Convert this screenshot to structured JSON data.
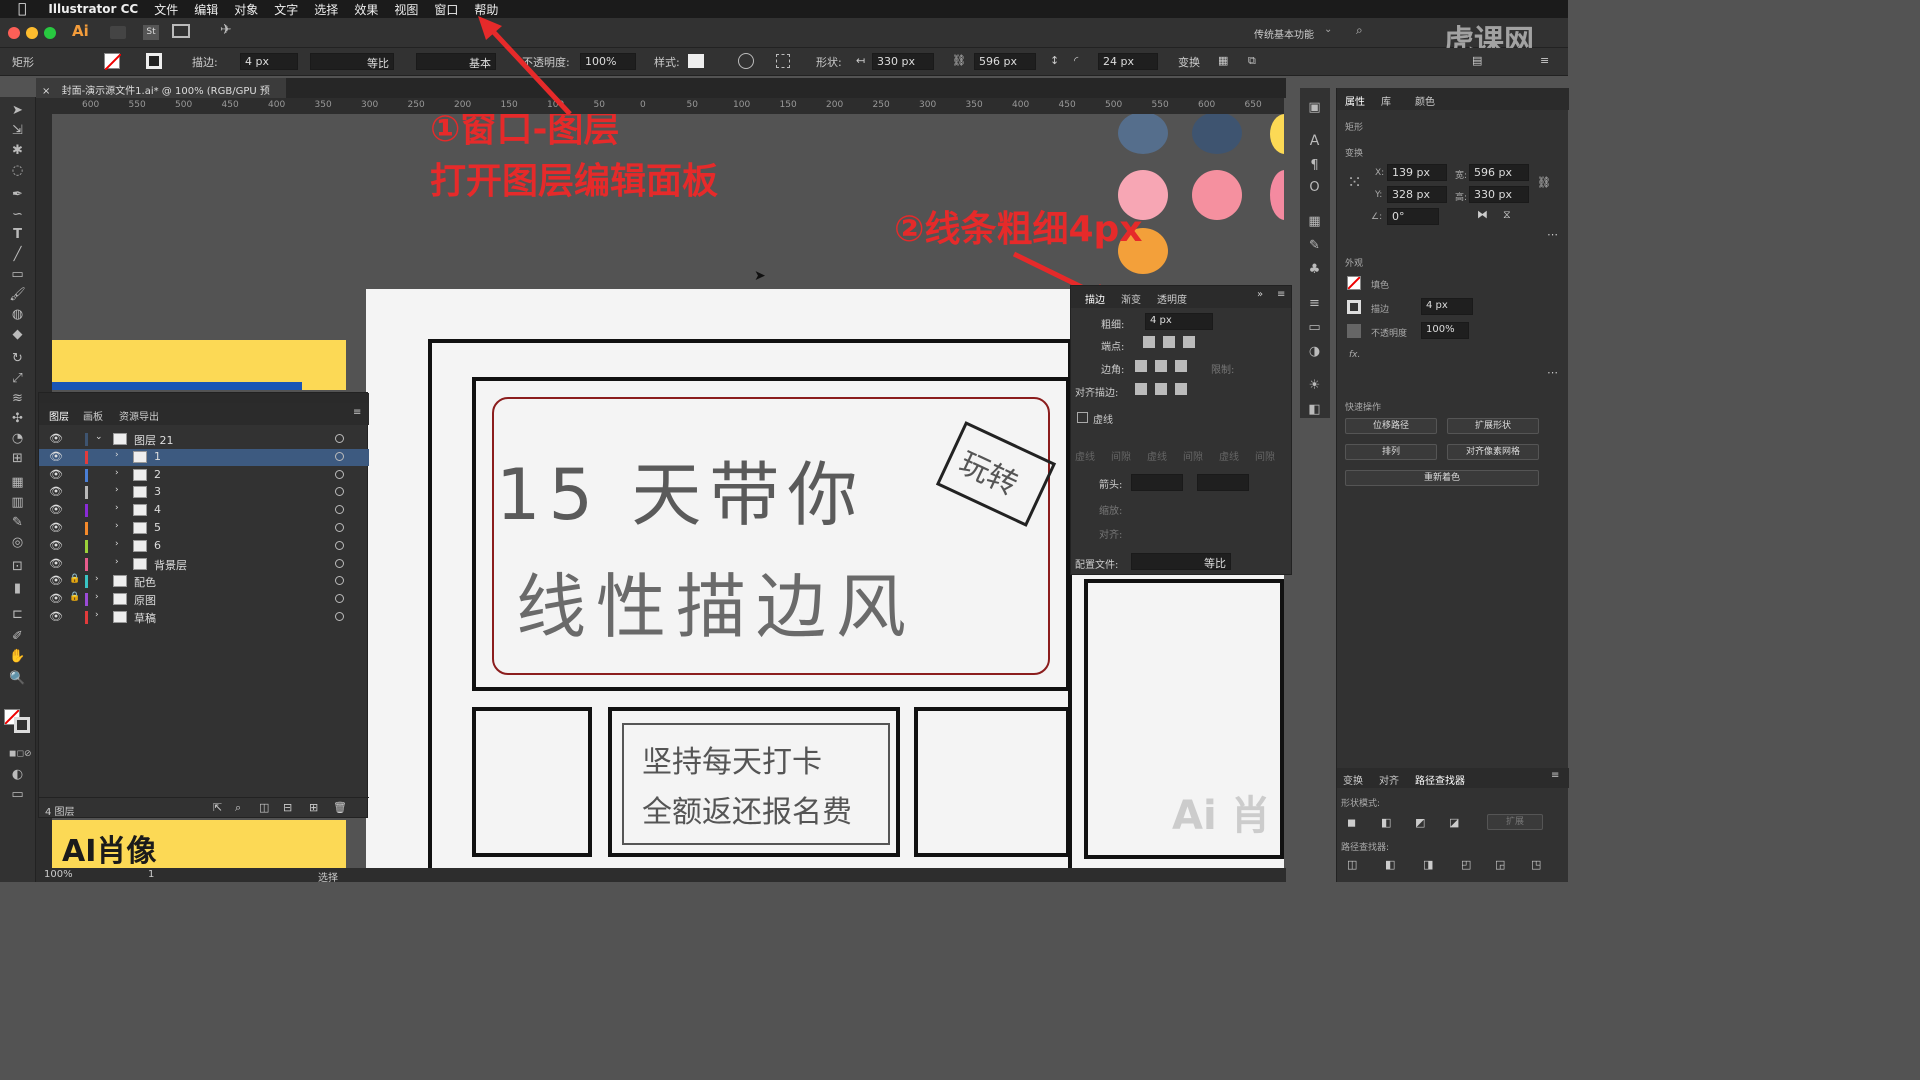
{
  "menubar": {
    "apple": "",
    "app_name": "Illustrator CC",
    "items": [
      "文件",
      "编辑",
      "对象",
      "文字",
      "选择",
      "效果",
      "视图",
      "窗口",
      "帮助"
    ]
  },
  "titlebar": {
    "ai_logo": "Ai",
    "st_logo": "St",
    "workspace": "传统基本功能",
    "watermark": "虎课网"
  },
  "control": {
    "object_type": "矩形",
    "stroke_label": "描边:",
    "stroke_value": "4 px",
    "profile_label": "等比",
    "brush_label": "基本",
    "opacity_label": "不透明度:",
    "opacity_value": "100%",
    "style_label": "样式:",
    "shape_label": "形状:",
    "width_value": "330 px",
    "height_value": "596 px",
    "corner_value": "24 px",
    "transform_label": "变换"
  },
  "document": {
    "tab_title": "封面-演示源文件1.ai* @ 100% (RGB/GPU 预览)",
    "close": "×"
  },
  "ruler": {
    "h_ticks": [
      "600",
      "550",
      "500",
      "450",
      "400",
      "350",
      "300",
      "250",
      "200",
      "150",
      "100",
      "50",
      "0",
      "50",
      "100",
      "150",
      "200",
      "250",
      "300",
      "350",
      "400",
      "450",
      "500",
      "550",
      "600",
      "650"
    ]
  },
  "annotations": {
    "step1_line1": "①窗口-图层",
    "step1_line2": "打开图层编辑面板",
    "step2": "②线条粗细4px"
  },
  "artwork": {
    "headline1": "15 天带你",
    "headline2": "线性描边风",
    "banner": "玩转",
    "box2_line1": "坚持每天打卡",
    "box2_line2": "全额返还报名费",
    "corner": "Ai 肖"
  },
  "colors": {
    "swatch1": "#556e8c",
    "swatch2": "#3e5470",
    "swatch3": "#f7a6b4",
    "swatch4": "#f5909f",
    "swatch5": "#f3a03a",
    "accent_yellow": "#fcd955",
    "annot_red": "#e62a2a"
  },
  "layers_panel": {
    "tabs": [
      "图层",
      "画板",
      "资源导出"
    ],
    "rows": [
      {
        "name": "图层 21",
        "color": "#3e5470",
        "locked": false,
        "expanded": true,
        "indent": 0
      },
      {
        "name": "1",
        "color": "#e23b3b",
        "locked": false,
        "expanded": false,
        "indent": 1,
        "selected": true
      },
      {
        "name": "2",
        "color": "#4a7fd6",
        "locked": false,
        "expanded": false,
        "indent": 1
      },
      {
        "name": "3",
        "color": "#b9b9b9",
        "locked": false,
        "expanded": false,
        "indent": 1
      },
      {
        "name": "4",
        "color": "#8a2bd6",
        "locked": false,
        "expanded": false,
        "indent": 1
      },
      {
        "name": "5",
        "color": "#f58a2b",
        "locked": false,
        "expanded": false,
        "indent": 1
      },
      {
        "name": "6",
        "color": "#9bd13a",
        "locked": false,
        "expanded": false,
        "indent": 1
      },
      {
        "name": "背景层",
        "color": "#e75c8c",
        "locked": false,
        "expanded": false,
        "indent": 1
      },
      {
        "name": "配色",
        "color": "#3ac4c4",
        "locked": true,
        "expanded": false,
        "indent": 0
      },
      {
        "name": "原图",
        "color": "#9b4bd6",
        "locked": true,
        "expanded": false,
        "indent": 0
      },
      {
        "name": "草稿",
        "color": "#e23b3b",
        "locked": false,
        "expanded": false,
        "indent": 0
      }
    ],
    "footer": "4 图层"
  },
  "stroke_panel": {
    "tabs": [
      "描边",
      "渐变",
      "透明度"
    ],
    "weight_label": "粗细:",
    "weight_value": "4 px",
    "cap_label": "端点:",
    "corner_label": "边角:",
    "limit_label": "限制:",
    "align_label": "对齐描边:",
    "dashed_label": "虚线",
    "dash_fields": [
      "虚线",
      "间隙",
      "虚线",
      "间隙",
      "虚线",
      "间隙"
    ],
    "arrow_label": "箭头:",
    "scale_label": "缩放:",
    "align2_label": "对齐:",
    "profile_label": "配置文件:",
    "profile_value": "等比"
  },
  "properties_panel": {
    "tabs": [
      "属性",
      "库",
      "颜色"
    ],
    "type": "矩形",
    "transform_title": "变换",
    "x_label": "X:",
    "x_value": "139 px",
    "w_label": "宽:",
    "w_value": "596 px",
    "y_label": "Y:",
    "y_value": "328 px",
    "h_label": "高:",
    "h_value": "330 px",
    "angle_label": "∠:",
    "angle_value": "0°",
    "appearance_title": "外观",
    "fill_label": "填色",
    "stroke_label": "描边",
    "stroke_value": "4 px",
    "opacity_label": "不透明度",
    "opacity_value": "100%",
    "fx": "fx.",
    "quick_title": "快速操作",
    "buttons": [
      "位移路径",
      "扩展形状",
      "排列",
      "对齐像素网格",
      "重新着色"
    ]
  },
  "pathfinder": {
    "tabs": [
      "变换",
      "对齐",
      "路径查找器"
    ],
    "shape_modes": "形状模式:",
    "expand": "扩展",
    "finders": "路径查找器:"
  },
  "status": {
    "zoom": "100%",
    "artboard": "1",
    "tool": "选择"
  }
}
